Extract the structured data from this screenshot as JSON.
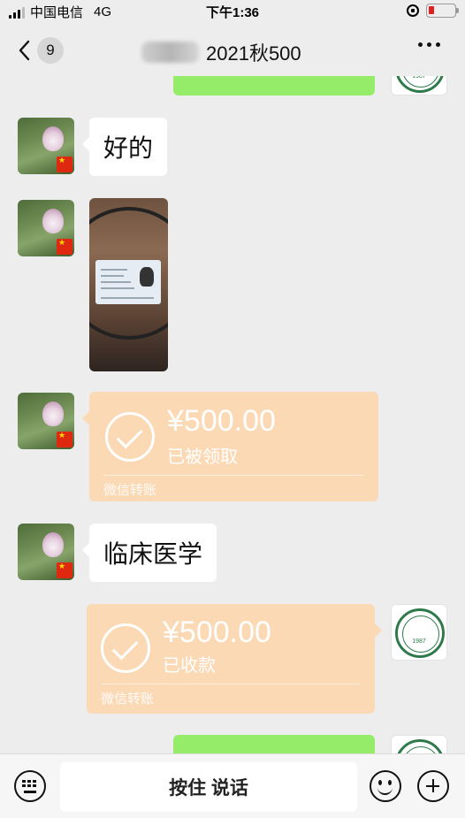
{
  "status_bar": {
    "carrier": "中国电信",
    "network": "4G",
    "time": "下午1:36"
  },
  "nav": {
    "unread_count": "9",
    "title": "2021秋500"
  },
  "messages": {
    "m1_text": "好的",
    "m4_amount": "¥500.00",
    "m4_status": "已被领取",
    "m4_footer": "微信转账",
    "m5_text": "临床医学",
    "m6_amount": "¥500.00",
    "m6_status": "已收款",
    "m6_footer": "微信转账",
    "emblem_year": "1987"
  },
  "bottom_bar": {
    "talk_label": "按住 说话"
  },
  "colors": {
    "background": "#ededed",
    "green_bubble": "#95ec69",
    "transfer_bubble": "#fbd9b5",
    "battery_low": "#e02020"
  },
  "icons": [
    "back-chevron-icon",
    "more-icon",
    "keyboard-icon",
    "emoji-icon",
    "plus-icon",
    "transfer-check-icon"
  ]
}
